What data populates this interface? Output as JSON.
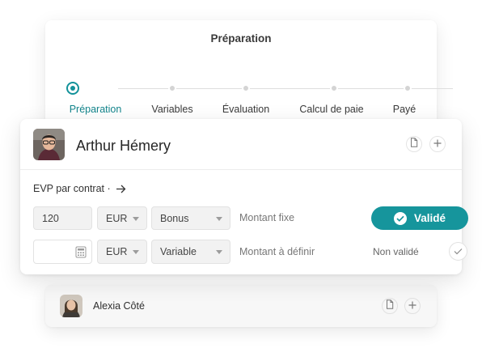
{
  "stepper": {
    "title": "Préparation",
    "steps": [
      {
        "label": "Préparation",
        "active": true
      },
      {
        "label": "Variables",
        "active": false
      },
      {
        "label": "Évaluation",
        "active": false
      },
      {
        "label": "Calcul de paie",
        "active": false
      },
      {
        "label": "Payé",
        "active": false
      }
    ]
  },
  "employee": {
    "name": "Arthur Hémery",
    "actions": {
      "document_icon": "document-icon",
      "add_icon": "plus-icon"
    }
  },
  "evp": {
    "title": "EVP par contrat ·",
    "arrow_icon": "arrow-right-icon",
    "rows": [
      {
        "amount": "120",
        "amount_placeholder": "",
        "currency": "EUR",
        "type": "Bonus",
        "hint": "Montant fixe",
        "status": "Validé"
      },
      {
        "amount": "",
        "amount_icon": "calculator-icon",
        "currency": "EUR",
        "type": "Variable",
        "hint": "Montant à définir",
        "status": "Non validé"
      }
    ]
  },
  "next_employee": {
    "name": "Alexia Côté"
  },
  "colors": {
    "accent": "#16959c",
    "accent_text": "#13858c"
  }
}
